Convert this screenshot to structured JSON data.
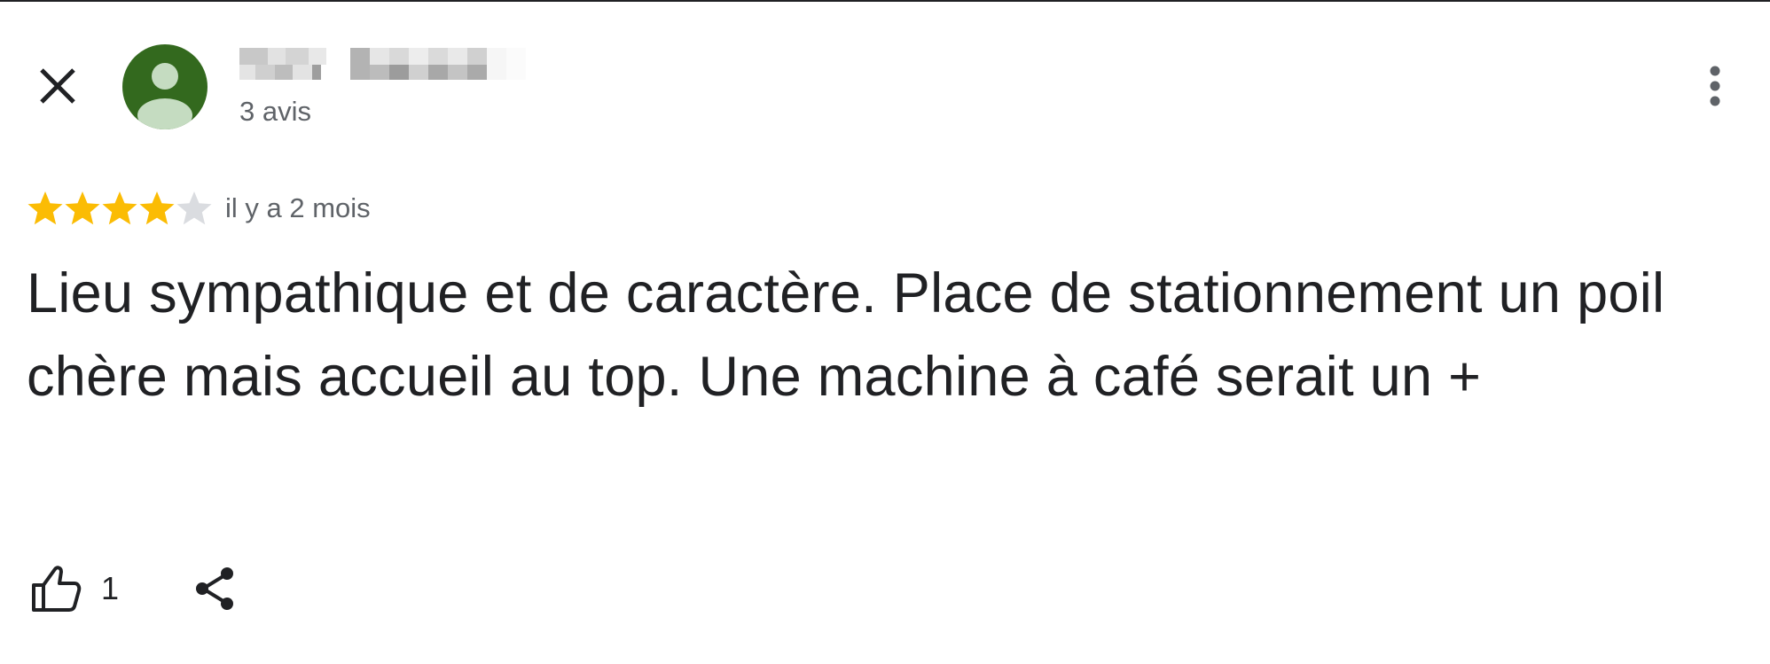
{
  "header": {
    "close_icon": "close-icon",
    "avatar_icon": "default-person-avatar",
    "avatar_color": "#33691e",
    "reviewer_name": "",
    "review_count": "3 avis",
    "menu_icon": "more-vert-icon"
  },
  "rating": {
    "stars": 4,
    "max_stars": 5,
    "filled_color": "#fbbc04",
    "empty_color": "#dadce0",
    "time_ago": "il y a 2 mois"
  },
  "review": {
    "text": "Lieu sympathique et de caractère. Place de stationnement un poil chère mais accueil au top. Une machine à café serait un +"
  },
  "actions": {
    "like_icon": "thumb-up-icon",
    "like_count": "1",
    "share_icon": "share-icon"
  }
}
